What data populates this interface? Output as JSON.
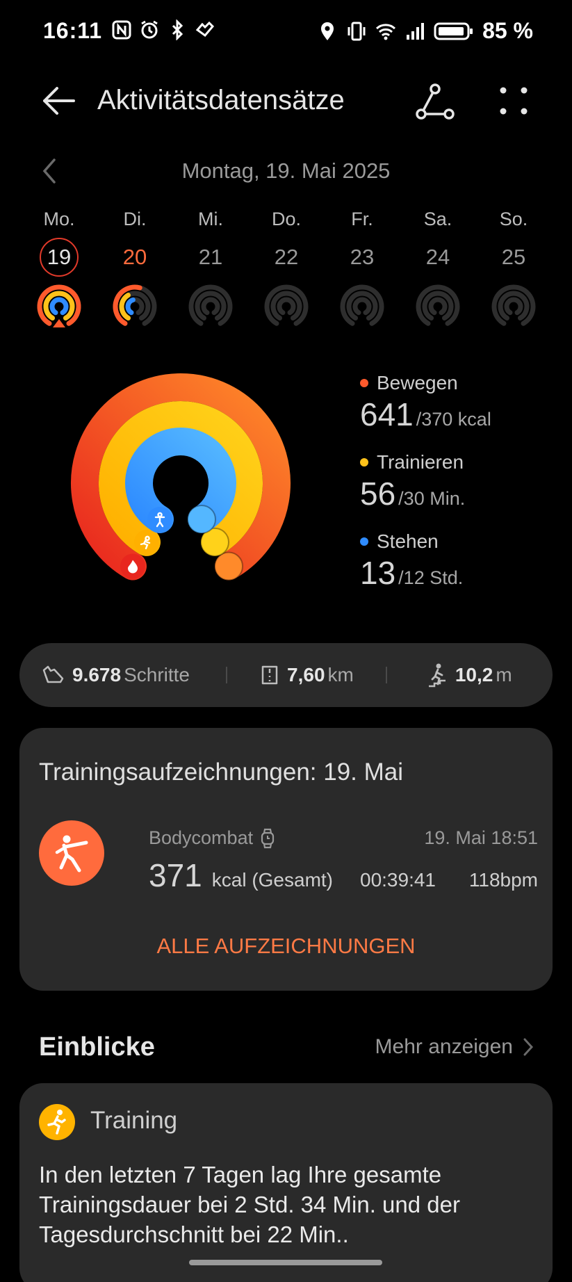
{
  "status_bar": {
    "time": "16:11",
    "battery": "85 %",
    "icons": [
      "nfc-icon",
      "alarm-icon",
      "bluetooth-icon",
      "health-sync-icon",
      "location-icon",
      "vibrate-icon",
      "wifi-icon",
      "signal-icon",
      "battery-icon"
    ]
  },
  "header": {
    "title": "Aktivitätsdatensätze",
    "icons": [
      "back-arrow-icon",
      "share-icon",
      "more-icon"
    ]
  },
  "date": {
    "label": "Montag, 19. Mai 2025"
  },
  "week": [
    {
      "name": "Mo.",
      "num": "19",
      "state": "selected",
      "move": 1.0,
      "exercise": 1.0,
      "stand": 1.0
    },
    {
      "name": "Di.",
      "num": "20",
      "state": "today",
      "move": 0.55,
      "exercise": 0.4,
      "stand": 0.45
    },
    {
      "name": "Mi.",
      "num": "21",
      "state": "future",
      "move": 0,
      "exercise": 0,
      "stand": 0
    },
    {
      "name": "Do.",
      "num": "22",
      "state": "future",
      "move": 0,
      "exercise": 0,
      "stand": 0
    },
    {
      "name": "Fr.",
      "num": "23",
      "state": "future",
      "move": 0,
      "exercise": 0,
      "stand": 0
    },
    {
      "name": "Sa.",
      "num": "24",
      "state": "future",
      "move": 0,
      "exercise": 0,
      "stand": 0
    },
    {
      "name": "So.",
      "num": "25",
      "state": "future",
      "move": 0,
      "exercise": 0,
      "stand": 0
    }
  ],
  "rings": {
    "move": {
      "label": "Bewegen",
      "value": "641",
      "goal": "/370 kcal",
      "color": "#ff5a2c"
    },
    "exercise": {
      "label": "Trainieren",
      "value": "56",
      "goal": "/30 Min.",
      "color": "#ffc21a"
    },
    "stand": {
      "label": "Stehen",
      "value": "13",
      "goal": "/12 Std.",
      "color": "#2f8cff"
    }
  },
  "stats": {
    "steps_value": "9.678",
    "steps_unit": "Schritte",
    "distance_value": "7,60",
    "distance_unit": "km",
    "climb_value": "10,2",
    "climb_unit": "m"
  },
  "training": {
    "title": "Trainingsaufzeichnungen: 19. Mai",
    "workout": {
      "name": "Bodycombat",
      "date": "19. Mai 18:51",
      "kcal": "371",
      "kcal_unit": "kcal (Gesamt)",
      "duration": "00:39:41",
      "bpm": "118bpm"
    },
    "all_records": "ALLE AUFZEICHNUNGEN"
  },
  "insights": {
    "title": "Einblicke",
    "more": "Mehr anzeigen",
    "card": {
      "label": "Training",
      "text": "In den letzten 7 Tagen lag Ihre gesamte Trainingsdauer bei 2 Std. 34 Min. und der Tagesdurchschnitt bei 22 Min.."
    }
  }
}
